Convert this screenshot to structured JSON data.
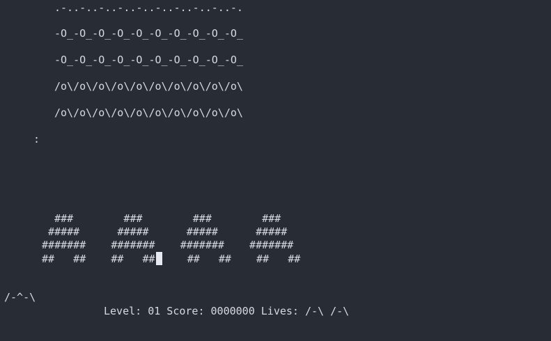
{
  "invaders": {
    "row1": ".-..-..-..-..-..-..-..-..-..-.",
    "row2": "-O_-O_-O_-O_-O_-O_-O_-O_-O_-O_",
    "row3": "-O_-O_-O_-O_-O_-O_-O_-O_-O_-O_",
    "row4": "/o\\/o\\/o\\/o\\/o\\/o\\/o\\/o\\/o\\/o\\",
    "row5": "/o\\/o\\/o\\/o\\/o\\/o\\/o\\/o\\/o\\/o\\"
  },
  "bomb": ":",
  "shields": {
    "row1": "   ###        ###        ###        ###",
    "row2": "  #####      #####      #####      #####",
    "row3": " #######    #######    #######    #######",
    "row4": " ##   ##    ##   ##    ##   ##    ##   ##",
    "row4a": " ##   ##    ##   ##",
    "row4b": "    ##   ##    ##   ##"
  },
  "player": "/-^-\\",
  "status": {
    "text": "Level: 01 Score: 0000000 Lives: /-\\ /-\\"
  }
}
